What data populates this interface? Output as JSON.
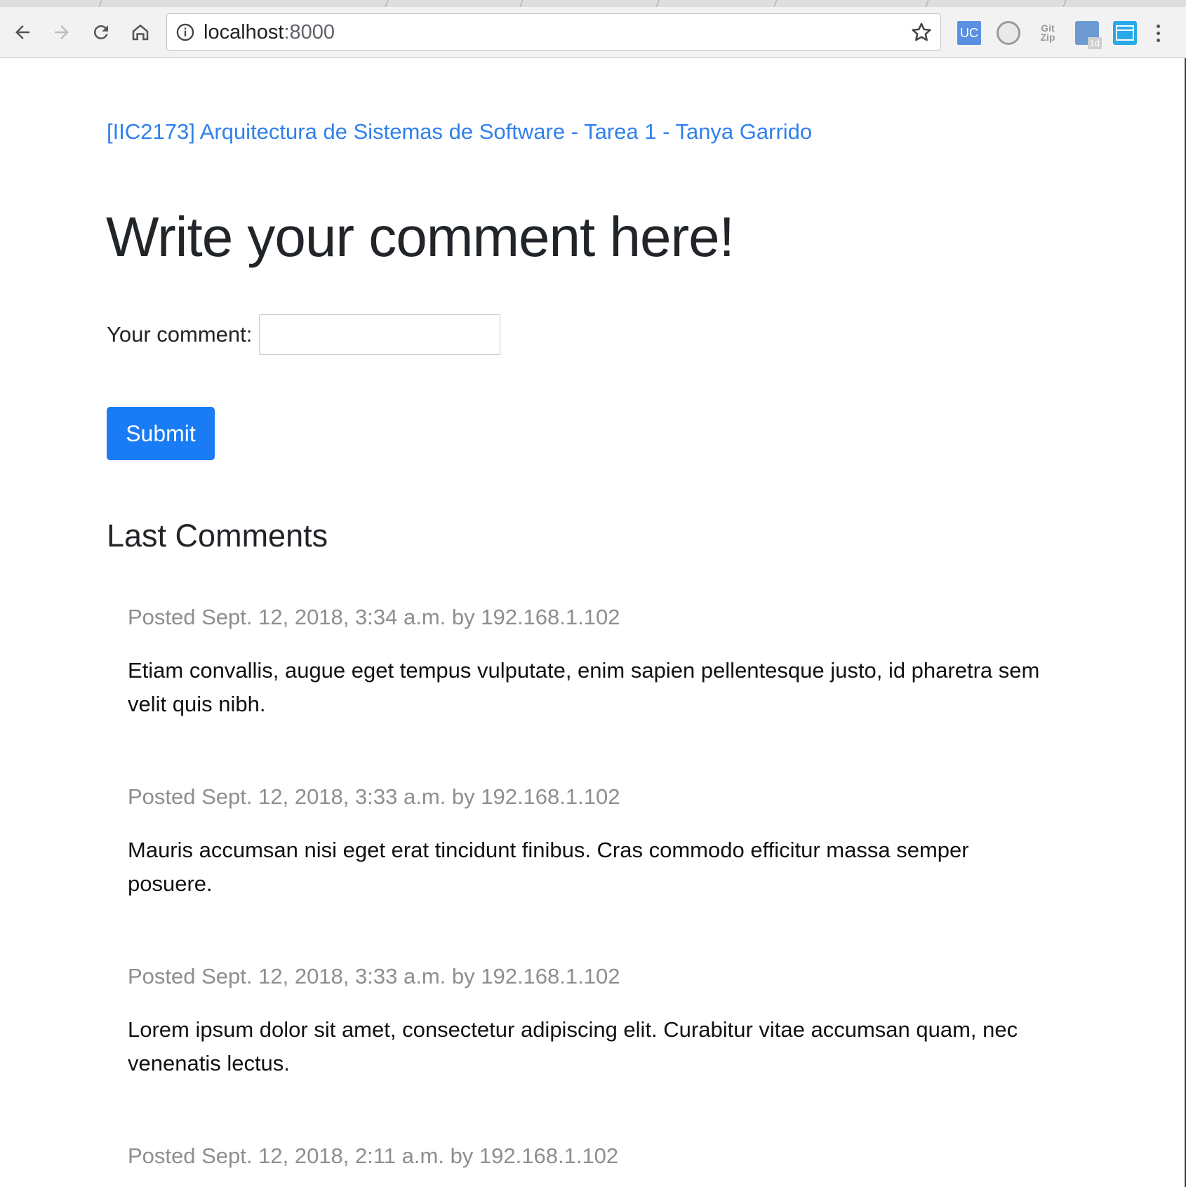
{
  "browser": {
    "url_host": "localhost",
    "url_port": ":8000",
    "extensions": {
      "uc_label": "UC",
      "git_label_top": "Git",
      "git_label_bottom": "Zip",
      "calendar_badge": "1d"
    }
  },
  "page": {
    "brand": "[IIC2173] Arquitectura de Sistemas de Software - Tarea 1 - Tanya Garrido",
    "heading": "Write your comment here!",
    "form": {
      "label": "Your comment:",
      "value": "",
      "submit_label": "Submit"
    },
    "section_title": "Last Comments",
    "comments": [
      {
        "meta": "Posted Sept. 12, 2018, 3:34 a.m. by 192.168.1.102",
        "text": "Etiam convallis, augue eget tempus vulputate, enim sapien pellentesque justo, id pharetra sem velit quis nibh."
      },
      {
        "meta": "Posted Sept. 12, 2018, 3:33 a.m. by 192.168.1.102",
        "text": "Mauris accumsan nisi eget erat tincidunt finibus. Cras commodo efficitur massa semper posuere."
      },
      {
        "meta": "Posted Sept. 12, 2018, 3:33 a.m. by 192.168.1.102",
        "text": "Lorem ipsum dolor sit amet, consectetur adipiscing elit. Curabitur vitae accumsan quam, nec venenatis lectus."
      },
      {
        "meta": "Posted Sept. 12, 2018, 2:11 a.m. by 192.168.1.102",
        "text": ""
      }
    ]
  },
  "colors": {
    "link": "#2f80ed",
    "button": "#1a7cf5",
    "meta_text": "#8e8e8e",
    "heading_text": "#212529"
  }
}
